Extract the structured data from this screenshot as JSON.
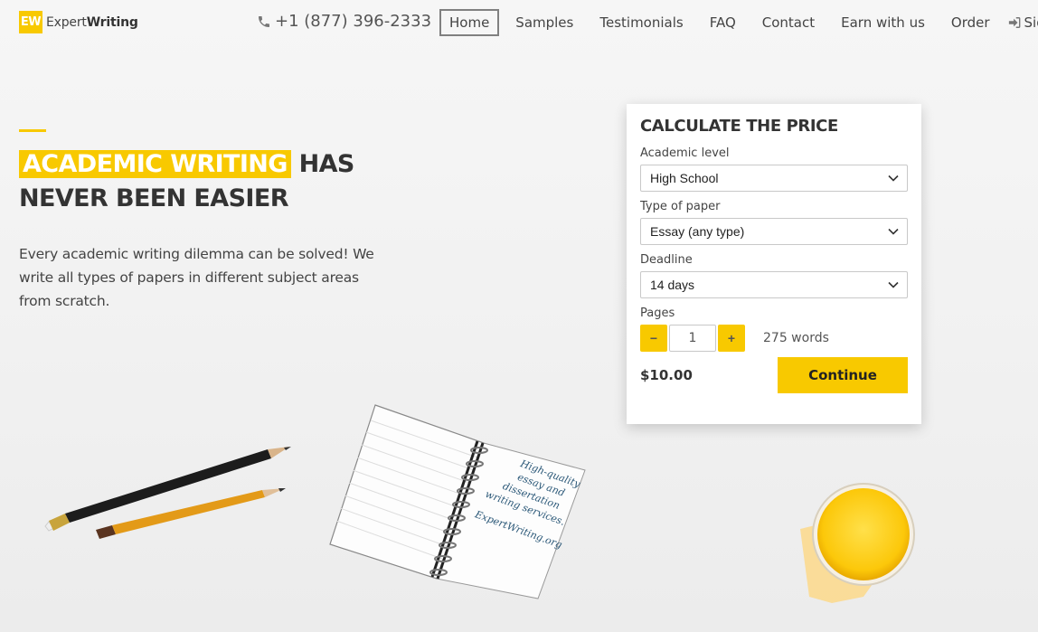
{
  "header": {
    "logo_badge": "EW",
    "logo_text_light": "Expert",
    "logo_text_bold": "Writing",
    "phone": "+1 (877) 396-2333",
    "nav": [
      {
        "label": "Home",
        "active": true
      },
      {
        "label": "Samples"
      },
      {
        "label": "Testimonials"
      },
      {
        "label": "FAQ"
      },
      {
        "label": "Contact"
      },
      {
        "label": "Earn with us"
      },
      {
        "label": "Order"
      }
    ],
    "sign_in": "Sign In"
  },
  "hero": {
    "title_highlight": "ACADEMIC WRITING",
    "title_rest1": " HAS",
    "title_rest2": "NEVER BEEN EASIER",
    "description": "Every academic writing dilemma can be solved! We write all types of papers in different subject areas from scratch."
  },
  "calculator": {
    "title": "CALCULATE THE PRICE",
    "academic_level_label": "Academic level",
    "academic_level_value": "High School",
    "paper_type_label": "Type of paper",
    "paper_type_value": "Essay (any type)",
    "deadline_label": "Deadline",
    "deadline_value": "14 days",
    "pages_label": "Pages",
    "minus": "−",
    "plus": "+",
    "pages_value": "1",
    "words": "275 words",
    "price": "$10.00",
    "continue_label": "Continue"
  },
  "illustrations": {
    "notebook_text": [
      "High-quality",
      "essay and",
      "dissertation",
      "writing services.",
      "ExpertWriting.org"
    ]
  },
  "colors": {
    "accent": "#f8c900",
    "text": "#333333",
    "background": "#f3f3f3"
  }
}
